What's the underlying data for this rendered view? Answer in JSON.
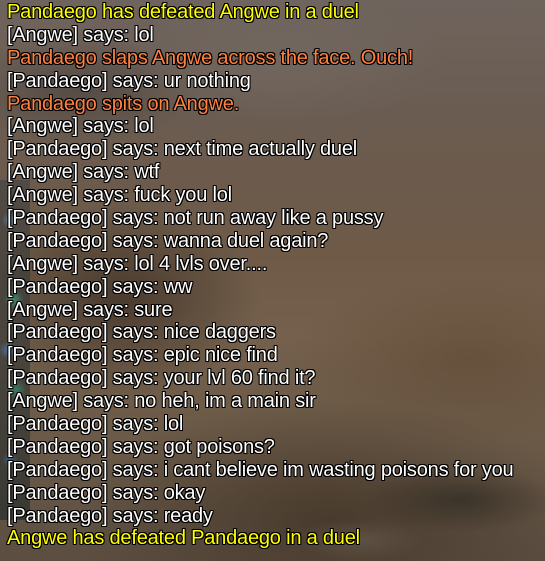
{
  "colors": {
    "system": "#ffff00",
    "say": "#ffffff",
    "emote": "#ff8040"
  },
  "chat_lines": [
    {
      "type": "system",
      "text": "Pandaego has defeated Angwe in a duel"
    },
    {
      "type": "say",
      "text": "[Angwe] says: lol"
    },
    {
      "type": "emote",
      "text": "Pandaego slaps Angwe across the face. Ouch!"
    },
    {
      "type": "say",
      "text": "[Pandaego] says: ur nothing"
    },
    {
      "type": "emote",
      "text": "Pandaego spits on Angwe."
    },
    {
      "type": "say",
      "text": "[Angwe] says: lol"
    },
    {
      "type": "say",
      "text": "[Pandaego] says: next time actually duel"
    },
    {
      "type": "say",
      "text": "[Angwe] says: wtf"
    },
    {
      "type": "say",
      "text": "[Angwe] says: fuck you lol"
    },
    {
      "type": "say",
      "text": "[Pandaego] says: not run away like a pussy"
    },
    {
      "type": "say",
      "text": "[Pandaego] says: wanna duel again?"
    },
    {
      "type": "say",
      "text": "[Angwe] says: lol 4 lvls over...."
    },
    {
      "type": "say",
      "text": "[Pandaego] says: ww"
    },
    {
      "type": "say",
      "text": "[Angwe] says: sure"
    },
    {
      "type": "say",
      "text": "[Pandaego] says: nice daggers"
    },
    {
      "type": "say",
      "text": "[Pandaego] says: epic nice find"
    },
    {
      "type": "say",
      "text": "[Pandaego] says: your lvl 60 find it?"
    },
    {
      "type": "say",
      "text": "[Angwe] says: no heh, im a main sir"
    },
    {
      "type": "say",
      "text": "[Pandaego] says: lol"
    },
    {
      "type": "say",
      "text": "[Pandaego] says: got poisons?"
    },
    {
      "type": "say",
      "text": "[Pandaego] says: i cant believe im wasting poisons for you"
    },
    {
      "type": "say",
      "text": "[Pandaego] says: okay"
    },
    {
      "type": "say",
      "text": "[Pandaego] says: ready"
    },
    {
      "type": "system",
      "text": "Angwe has defeated Pandaego in a duel"
    }
  ]
}
